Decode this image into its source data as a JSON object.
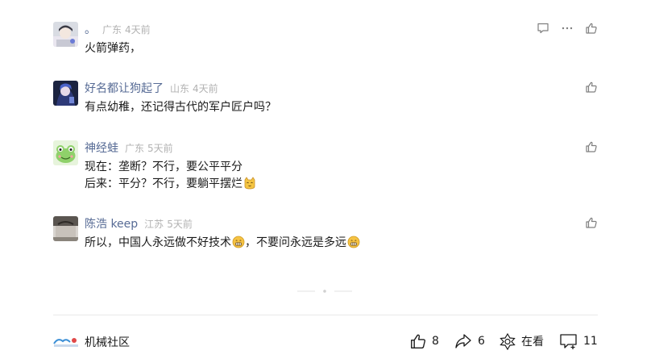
{
  "comments": [
    {
      "nickname": "。",
      "location": "广东",
      "time": "4天前",
      "lines": [
        "火箭弹药，"
      ]
    },
    {
      "nickname": "好名都让狗起了",
      "location": "山东",
      "time": "4天前",
      "lines": [
        "有点幼稚，还记得古代的军户匠户吗？"
      ]
    },
    {
      "nickname": "神经蛙",
      "location": "广东",
      "time": "5天前",
      "lines": [
        "现在：垄断？不行，要公平平分",
        "后来：平分？不行，要躺平摆烂"
      ]
    },
    {
      "nickname": "陈浩 keep",
      "location": "江苏",
      "time": "5天前",
      "lines": [
        "所以，中国人永远做不好技术",
        "，不要问永远是多远"
      ]
    }
  ],
  "footer": {
    "account_name": "机械社区",
    "like_count": "8",
    "share_count": "6",
    "watching_label": "在看",
    "comment_count": "11"
  },
  "icons": {
    "reply": "comment-bubble-icon",
    "more": "more-icon",
    "like": "thumb-up-icon",
    "share": "share-arrow-icon",
    "watching": "flower-icon"
  },
  "colors": {
    "nickname": "#576b95",
    "meta": "#b2b2b2",
    "text": "#1a1a1a",
    "icon": "#7f7f7f"
  }
}
